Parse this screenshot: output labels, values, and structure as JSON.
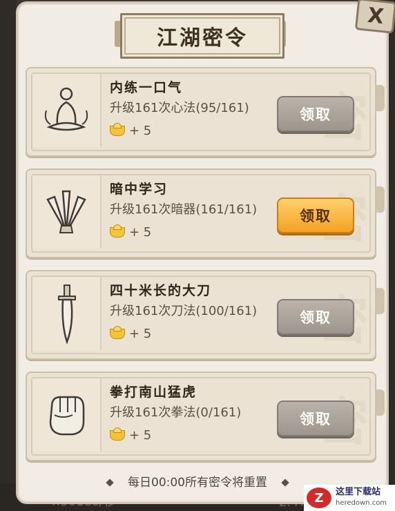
{
  "title": "江湖密令",
  "close_label": "X",
  "tasks": [
    {
      "title": "内练一口气",
      "desc": "升级161次心法(95/161)",
      "reward": "+ 5",
      "button": "领取",
      "icon": "meditating-monk-icon",
      "state": "disabled"
    },
    {
      "title": "暗中学习",
      "desc": "升级161次暗器(161/161)",
      "reward": "+ 5",
      "button": "领取",
      "icon": "throwing-knives-icon",
      "state": "active"
    },
    {
      "title": "四十米长的大刀",
      "desc": "升级161次刀法(100/161)",
      "reward": "+ 5",
      "button": "领取",
      "icon": "broadsword-icon",
      "state": "disabled"
    },
    {
      "title": "拳打南山猛虎",
      "desc": "升级161次拳法(0/161)",
      "reward": "+ 5",
      "button": "领取",
      "icon": "fist-icon",
      "state": "disabled"
    }
  ],
  "footer": "每日00:00所有密令将重置",
  "watermark": {
    "name": "这里下载站",
    "url": "heredown.com",
    "logo": "Z"
  },
  "background_text": {
    "left": "4.301ee/秒",
    "right": "2.47"
  },
  "colors": {
    "active_button": "#f3a224",
    "disabled_button": "#9c968d",
    "panel": "#f2ede4"
  }
}
